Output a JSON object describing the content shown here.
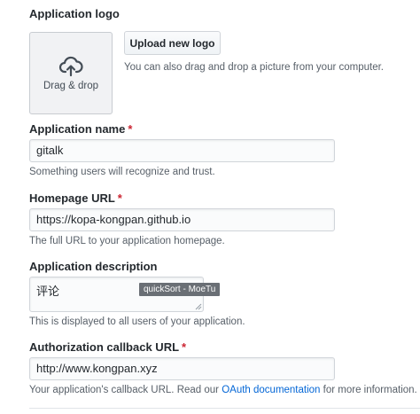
{
  "logo": {
    "label": "Application logo",
    "drop_text": "Drag & drop",
    "upload_button": "Upload new logo",
    "hint": "You can also drag and drop a picture from your computer."
  },
  "name": {
    "label": "Application name",
    "required_mark": "*",
    "value": "gitalk",
    "note": "Something users will recognize and trust."
  },
  "homepage": {
    "label": "Homepage URL",
    "required_mark": "*",
    "value": "https://kopa-kongpan.github.io",
    "note": "The full URL to your application homepage."
  },
  "description": {
    "label": "Application description",
    "value": "评论",
    "tooltip": "quickSort - MoeTu",
    "note": "This is displayed to all users of your application."
  },
  "callback": {
    "label": "Authorization callback URL",
    "required_mark": "*",
    "value": "http://www.kongpan.xyz",
    "note_before": "Your application's callback URL. Read our ",
    "note_link": "OAuth documentation",
    "note_after": " for more information."
  }
}
